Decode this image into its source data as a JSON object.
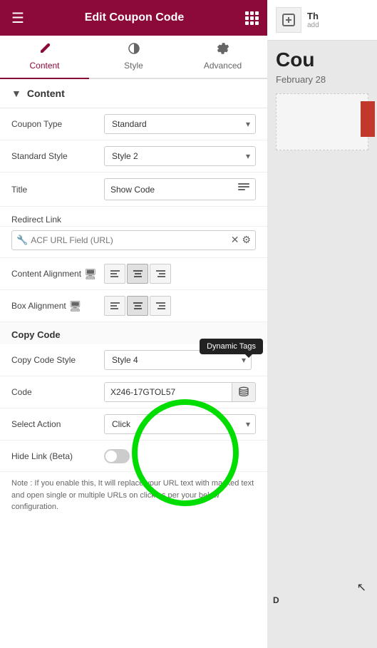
{
  "header": {
    "title": "Edit Coupon Code",
    "hamburger": "☰",
    "grid": "⊞"
  },
  "tabs": [
    {
      "id": "content",
      "label": "Content",
      "icon": "✏️",
      "active": true
    },
    {
      "id": "style",
      "label": "Style",
      "icon": "◑",
      "active": false
    },
    {
      "id": "advanced",
      "label": "Advanced",
      "icon": "⚙",
      "active": false
    }
  ],
  "section": {
    "label": "Content"
  },
  "fields": {
    "coupon_type_label": "Coupon Type",
    "coupon_type_value": "Standard",
    "standard_style_label": "Standard Style",
    "standard_style_value": "Style 2",
    "title_label": "Title",
    "title_value": "Show Code",
    "redirect_link_label": "Redirect Link",
    "redirect_link_placeholder": "ACF URL Field (URL)",
    "content_alignment_label": "Content Alignment",
    "box_alignment_label": "Box Alignment",
    "copy_code_label": "Copy Code",
    "copy_code_style_label": "Copy Code Style",
    "copy_code_style_value": "Style 4",
    "dynamic_tags_label": "Dynamic Tags",
    "code_label": "Code",
    "code_value": "X246-17GTOL57",
    "select_action_label": "Select Action",
    "select_action_value": "Click",
    "hide_link_label": "Hide Link (Beta)",
    "note_text": "Note : If you enable this, It will replace your URL text with masked text and open single or multiple URLs on click as per your below configuration."
  },
  "preview": {
    "title": "Th",
    "subtitle": "add",
    "heading": "Cou",
    "date": "February 28"
  },
  "icons": {
    "stack": "≡",
    "gear": "⚙",
    "pencil": "✏",
    "wrench": "🔧",
    "circle_half": "◑",
    "align_left": "≡",
    "align_center": "≡",
    "align_right": "≡",
    "monitor": "🖥",
    "database": "🗄",
    "close": "✕"
  }
}
